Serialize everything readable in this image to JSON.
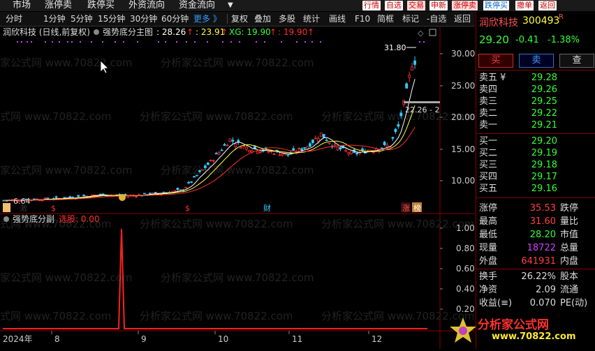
{
  "topnav": {
    "items": [
      "市场",
      "涨停卖",
      "跌停买",
      "外资流向",
      "资金流向"
    ],
    "more_arrow": "▼",
    "right_buttons": [
      "行情",
      "自选",
      "交易",
      "申新",
      "涨停卖",
      "跌停买",
      "撤单",
      "返回"
    ]
  },
  "toolbar": {
    "periods": [
      "分时",
      "1分钟",
      "5分钟",
      "15分钟",
      "30分钟",
      "60分钟",
      "更多 》"
    ],
    "actions": [
      "复权",
      "叠加",
      "多股",
      "统计",
      "画线",
      "F10",
      "简框",
      "标记",
      "-自选",
      "返回"
    ]
  },
  "main_panel": {
    "title": "润欣科技 (日线,前复权)",
    "indicator_name": "强势底分主图",
    "indicator_value": ": 28.26",
    "val2": ": 23.91",
    "xg": "XG: 19.90",
    "val4": ": 19.90",
    "high_label": "31.80",
    "low_label": "6.64",
    "line_label": "22.26 - 2",
    "y_ticks": [
      "30.00",
      "25.00",
      "20.00",
      "15.00",
      "10.00"
    ],
    "markers": [
      "激",
      "$",
      "$",
      "财",
      "涨",
      "榜"
    ],
    "watermark": "分析家公式网 www.70822.com"
  },
  "sub_panel": {
    "name": "强势底分副",
    "label": "选股: 0.00",
    "y_ticks": [
      "1.00",
      "0.80",
      "0.60",
      "0.40",
      "0.20"
    ]
  },
  "x_axis": [
    "2024年",
    "8",
    "9",
    "10",
    "11",
    "12"
  ],
  "quote": {
    "name": "润欣科技",
    "code": "300493",
    "r_flag": "R",
    "price": "29.20",
    "change": "-0.41",
    "change_pct": "-1.38%",
    "buy_btn": "买",
    "sell_btn": "卖",
    "check_btn": "查",
    "sell_orders": [
      {
        "label": "卖五 ¥",
        "price": "29.28"
      },
      {
        "label": "卖四",
        "price": "29.26"
      },
      {
        "label": "卖三",
        "price": "29.25"
      },
      {
        "label": "卖二",
        "price": "29.22"
      },
      {
        "label": "卖一",
        "price": "29.21"
      }
    ],
    "buy_orders": [
      {
        "label": "买一",
        "price": "29.20"
      },
      {
        "label": "买二",
        "price": "29.19"
      },
      {
        "label": "买三",
        "price": "29.18"
      },
      {
        "label": "买四",
        "price": "29.17"
      },
      {
        "label": "买五",
        "price": "29.16"
      }
    ],
    "stats": [
      {
        "l1": "涨停",
        "v1": "35.53",
        "l2": "跌停"
      },
      {
        "l1": "最高",
        "v1": "31.60",
        "l2": "量比"
      },
      {
        "l1": "最低",
        "v1": "28.20",
        "l2": "市值"
      },
      {
        "l1": "现量",
        "v1": "18722",
        "l2": "总量"
      },
      {
        "l1": "外盘",
        "v1": "641931",
        "l2": "内盘"
      }
    ],
    "stats2": [
      {
        "l1": "换手",
        "v1": "26.22%",
        "l2": "股本"
      },
      {
        "l1": "净资",
        "v1": "2.09",
        "l2": "流通"
      },
      {
        "l1": "收益(≡)",
        "v1": "0.070",
        "l2": "PE(动)"
      }
    ],
    "logo_text": "分析家公式网",
    "logo_url": "www.70822.com"
  },
  "colors": {
    "up": "#ff3030",
    "down": "#33ccff",
    "ma1": "#ffffff",
    "ma2": "#ffff40",
    "ma3": "#ff3030"
  }
}
